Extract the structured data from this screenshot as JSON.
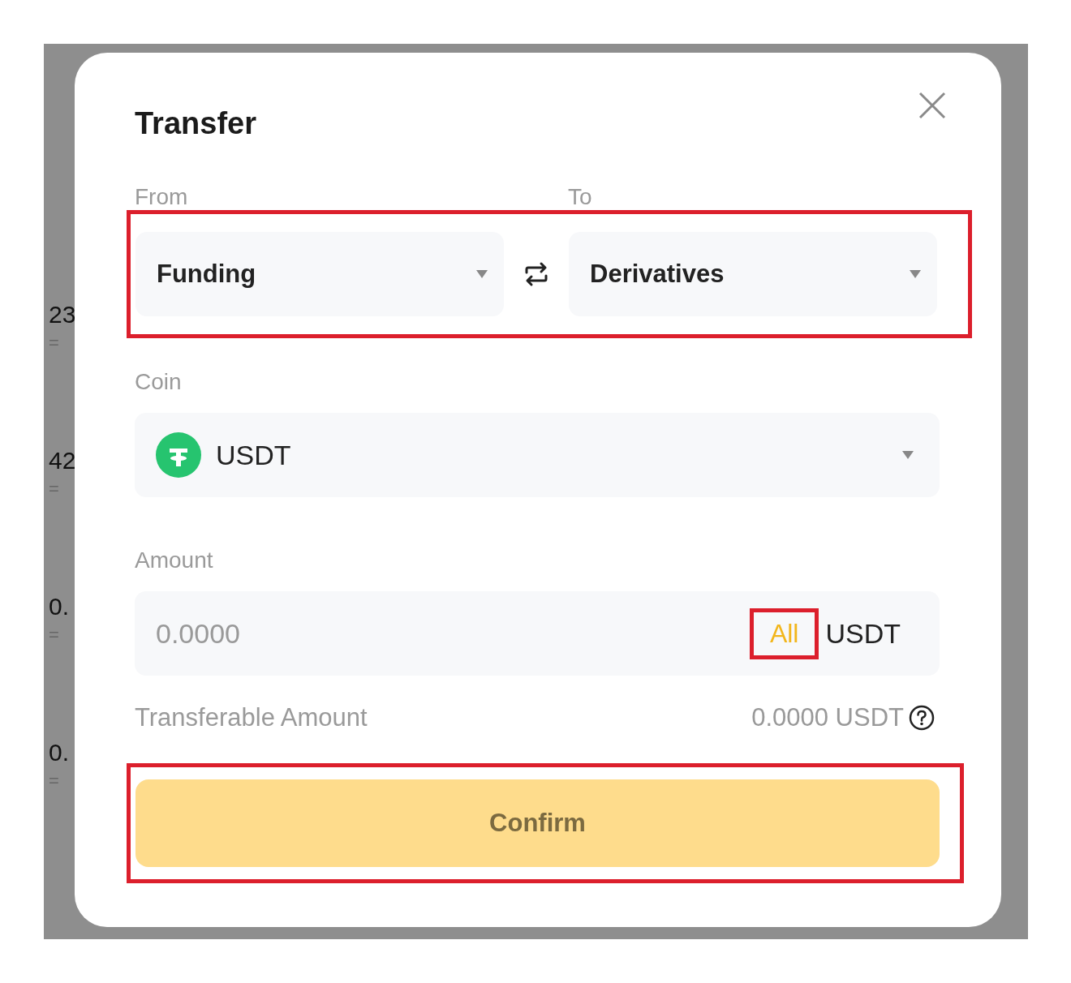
{
  "background_values": [
    {
      "value": "23",
      "sub": "="
    },
    {
      "value": "42",
      "sub": "="
    },
    {
      "value": "0.",
      "sub": "="
    },
    {
      "value": "0.",
      "sub": "="
    }
  ],
  "dialog": {
    "title": "Transfer",
    "accounts": {
      "highlighted": true,
      "from_label": "From",
      "to_label": "To",
      "from": "Funding",
      "to": "Derivatives"
    },
    "coin": {
      "label": "Coin",
      "value": "USDT"
    },
    "amount": {
      "label": "Amount",
      "placeholder": "0.0000",
      "all_button": {
        "label": "All",
        "highlighted": true
      },
      "unit": "USDT"
    },
    "transferable": {
      "label": "Transferable Amount",
      "value": "0.0000 USDT"
    },
    "confirm_button": {
      "label": "Confirm",
      "highlighted": true
    }
  }
}
